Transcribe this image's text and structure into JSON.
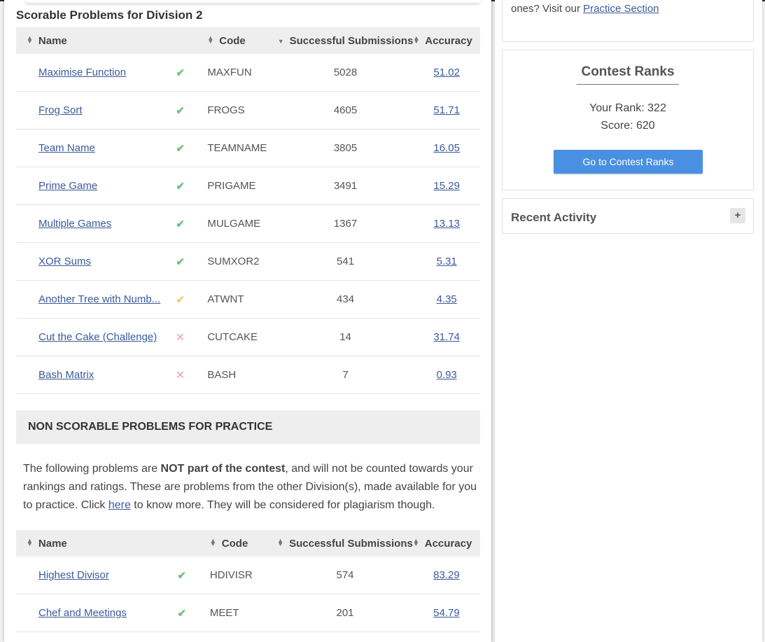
{
  "section_title": "Scorable Problems for Division 2",
  "columns": {
    "name": "Name",
    "code": "Code",
    "successful_submissions": "Successful Submissions",
    "accuracy": "Accuracy"
  },
  "problems": [
    {
      "name": "Maximise Function",
      "status": "solved",
      "code": "MAXFUN",
      "submissions": "5028",
      "accuracy": "51.02"
    },
    {
      "name": "Frog Sort",
      "status": "solved",
      "code": "FROGS",
      "submissions": "4605",
      "accuracy": "51.71"
    },
    {
      "name": "Team Name",
      "status": "solved",
      "code": "TEAMNAME",
      "submissions": "3805",
      "accuracy": "16.05"
    },
    {
      "name": "Prime Game",
      "status": "solved",
      "code": "PRIGAME",
      "submissions": "3491",
      "accuracy": "15.29"
    },
    {
      "name": "Multiple Games",
      "status": "solved",
      "code": "MULGAME",
      "submissions": "1367",
      "accuracy": "13.13"
    },
    {
      "name": "XOR Sums",
      "status": "solved",
      "code": "SUMXOR2",
      "submissions": "541",
      "accuracy": "5.31"
    },
    {
      "name": "Another Tree with Numb...",
      "status": "partial",
      "code": "ATWNT",
      "submissions": "434",
      "accuracy": "4.35"
    },
    {
      "name": "Cut the Cake (Challenge)",
      "status": "wrong",
      "code": "CUTCAKE",
      "submissions": "14",
      "accuracy": "31.74"
    },
    {
      "name": "Bash Matrix",
      "status": "wrong",
      "code": "BASH",
      "submissions": "7",
      "accuracy": "0.93"
    }
  ],
  "non_scorable": {
    "title": "NON SCORABLE PROBLEMS FOR PRACTICE",
    "text_1": "The following problems are ",
    "text_bold": "NOT part of the contest",
    "text_2": ", and will not be counted towards your rankings and ratings. These are problems from the other Division(s), made available for you to practice. Click ",
    "link": "here",
    "text_3": " to know more. They will be considered for plagiarism though.",
    "problems": [
      {
        "name": "Highest Divisor",
        "status": "solved",
        "code": "HDIVISR",
        "submissions": "574",
        "accuracy": "83.29"
      },
      {
        "name": "Chef and Meetings",
        "status": "solved",
        "code": "MEET",
        "submissions": "201",
        "accuracy": "54.79"
      }
    ]
  },
  "sidebar": {
    "practice_text": "ones? Visit our ",
    "practice_link": "Practice Section",
    "ranks_title": "Contest Ranks",
    "your_rank": "Your Rank: 322",
    "score": "Score: 620",
    "ranks_button": "Go to Contest Ranks",
    "recent_activity": "Recent Activity",
    "plus": "+"
  },
  "colors": {
    "link": "#3c5a9a",
    "button": "#4a90e2",
    "solved": "#6ec07e",
    "partial": "#e6d16b",
    "wrong": "#f0a3a3"
  }
}
